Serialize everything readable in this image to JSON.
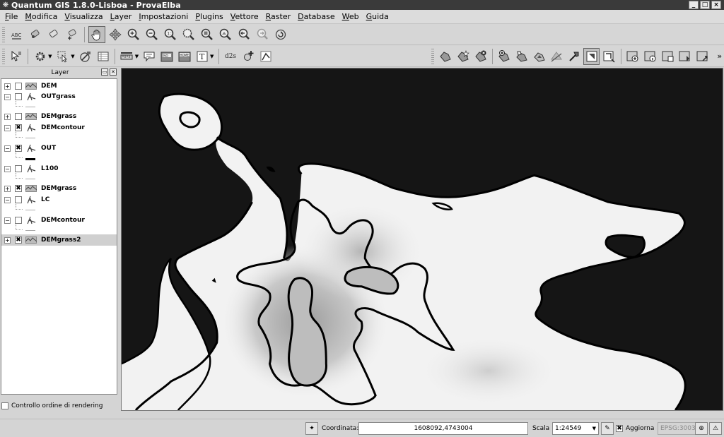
{
  "window": {
    "title": "Quantum GIS 1.8.0-Lisboa - ProvaElba",
    "app_icon": "qgis-icon",
    "controls": [
      "_",
      "□",
      "×"
    ]
  },
  "menu": [
    {
      "label": "File",
      "mnemonic": "F",
      "rest": "ile"
    },
    {
      "label": "Modifica",
      "mnemonic": "M",
      "rest": "odifica"
    },
    {
      "label": "Visualizza",
      "mnemonic": "V",
      "rest": "isualizza"
    },
    {
      "label": "Layer",
      "mnemonic": "L",
      "rest": "ayer"
    },
    {
      "label": "Impostazioni",
      "mnemonic": "I",
      "rest": "mpostazioni"
    },
    {
      "label": "Plugins",
      "mnemonic": "P",
      "rest": "lugins"
    },
    {
      "label": "Vettore",
      "mnemonic": "V",
      "rest": "ettore"
    },
    {
      "label": "Raster",
      "mnemonic": "R",
      "rest": "aster"
    },
    {
      "label": "Database",
      "mnemonic": "D",
      "rest": "atabase"
    },
    {
      "label": "Web",
      "mnemonic": "W",
      "rest": "eb"
    },
    {
      "label": "Guida",
      "mnemonic": "G",
      "rest": "uida"
    }
  ],
  "toolbar2": {
    "measure_label": "d2s",
    "home_label": "HOME",
    "more": "»"
  },
  "layer_panel": {
    "title": "Layer",
    "layers": [
      {
        "name": "DEM",
        "type": "raster",
        "checked": false
      },
      {
        "name": "OUTgrass",
        "type": "vector",
        "checked": false
      },
      {
        "name": "DEMgrass",
        "type": "raster",
        "checked": false
      },
      {
        "name": "DEMcontour",
        "type": "vector",
        "checked": true
      },
      {
        "name": "OUT",
        "type": "vector",
        "checked": true
      },
      {
        "name": "L100",
        "type": "vector",
        "checked": false
      },
      {
        "name": "DEMgrass",
        "type": "raster",
        "checked": true
      },
      {
        "name": "LC",
        "type": "vector",
        "checked": false
      },
      {
        "name": "DEMcontour",
        "type": "vector",
        "checked": false
      },
      {
        "name": "DEMgrass2",
        "type": "raster",
        "checked": true,
        "selected": true
      }
    ],
    "check_mark": "✖",
    "render_order_label": "Controllo ordine di rendering"
  },
  "statusbar": {
    "coord_label": "Coordinata:",
    "coord_value": "1608092,4743004",
    "scale_label": "Scala",
    "scale_value": "1:24549",
    "refresh_label": "Aggiorna",
    "refresh_checked": true,
    "crs_label": "EPSG:3003"
  },
  "colors": {
    "titlebar": "#3a3a3a",
    "map_background": "#151515",
    "land": "#f2f2f2",
    "contour": "#000000"
  }
}
